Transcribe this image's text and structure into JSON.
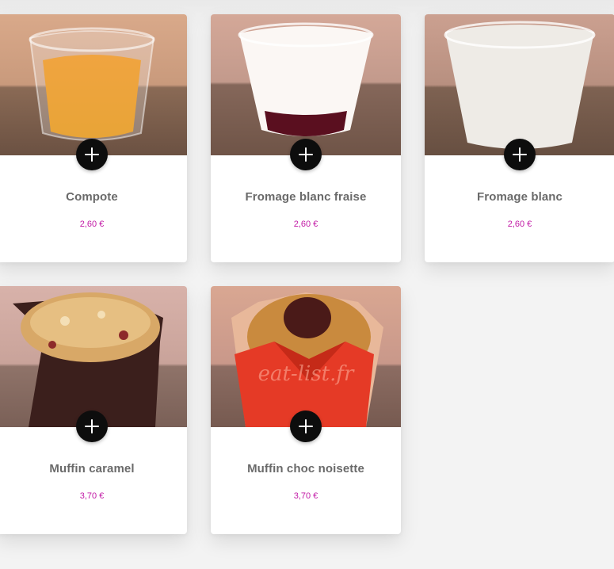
{
  "products": [
    {
      "name": "Compote",
      "price": "2,60 €",
      "image": "compote cup",
      "add_icon": "plus-icon"
    },
    {
      "name": "Fromage blanc fraise",
      "price": "2,60 €",
      "image": "fromage blanc with strawberry cup",
      "add_icon": "plus-icon"
    },
    {
      "name": "Fromage blanc",
      "price": "2,60 €",
      "image": "fromage blanc cup",
      "add_icon": "plus-icon"
    },
    {
      "name": "Muffin caramel",
      "price": "3,70 €",
      "image": "caramel muffin",
      "add_icon": "plus-icon"
    },
    {
      "name": "Muffin choc noisette",
      "price": "3,70 €",
      "image": "chocolate hazelnut muffin",
      "watermark": "eat-list.fr",
      "add_icon": "plus-icon"
    }
  ],
  "colors": {
    "price": "#c21aa6",
    "name": "#6a6a6a",
    "add_button": "#0d0d0d",
    "background": "#f3f3f3"
  }
}
